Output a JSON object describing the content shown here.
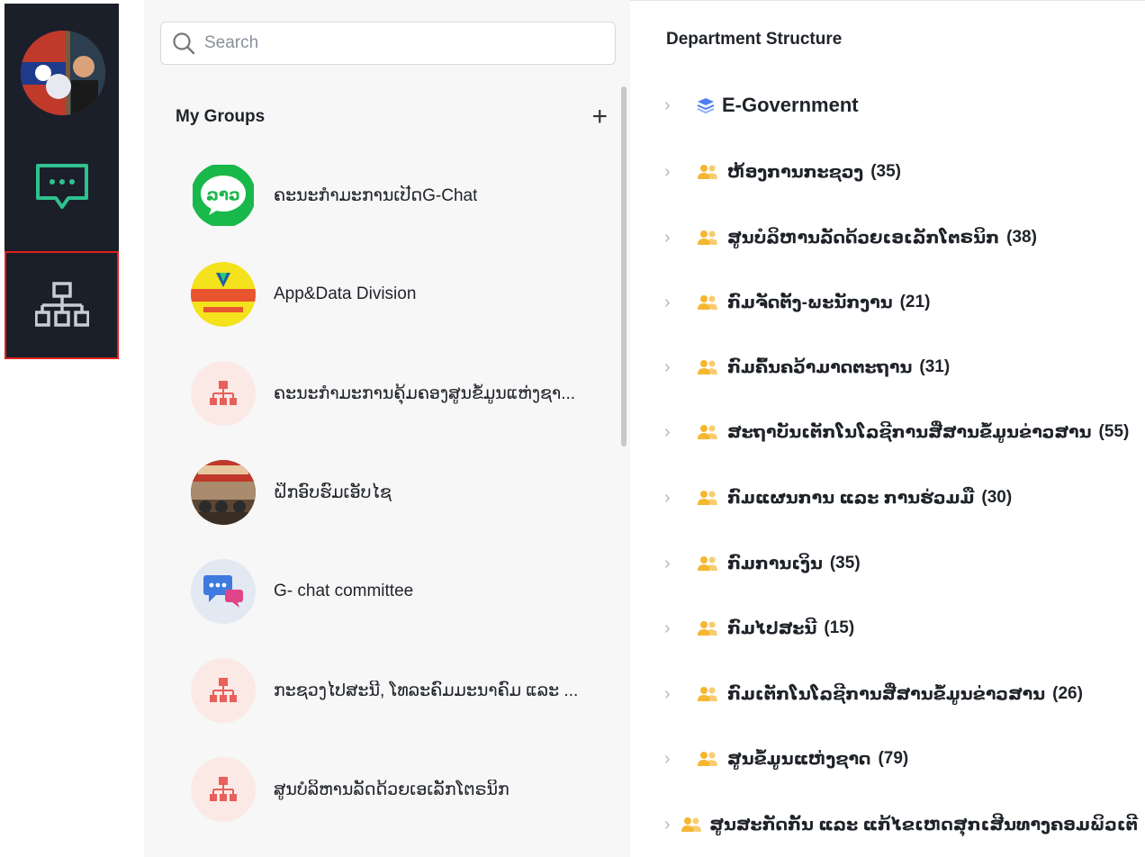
{
  "rail": {
    "items": [
      {
        "name": "chat",
        "icon": "chat-bubble-icon"
      },
      {
        "name": "organization",
        "icon": "org-chart-icon",
        "active": true
      }
    ],
    "colors": {
      "background": "#1b1f2a",
      "chat_icon": "#2ec28e",
      "active_border": "#e02020"
    }
  },
  "groups_panel": {
    "search": {
      "placeholder": "Search",
      "value": ""
    },
    "title": "My Groups",
    "add_label": "+",
    "items": [
      {
        "name": "ຄະນະກຳມະການເປີດG-Chat",
        "avatar": "lao-chat-logo"
      },
      {
        "name": "App&Data Division",
        "avatar": "application-data-logo"
      },
      {
        "name": "ຄະນະກຳມະການຄຸ້ມຄອງສູນຂໍ້ມູນແຫ່ງຊາ...",
        "avatar": "org-chart-icon"
      },
      {
        "name": "ຝຶກອົບຮົມເອັບໄຊ",
        "avatar": "photo"
      },
      {
        "name": "G- chat committee",
        "avatar": "chat-bubbles-icon"
      },
      {
        "name": "ກະຊວງໄປສະນີ, ໂທລະຄົມມະນາຄົມ ແລະ ...",
        "avatar": "org-chart-icon"
      },
      {
        "name": "ສູນບໍລິຫານລັດດ້ວຍເອເລັກໂຕຣນິກ",
        "avatar": "org-chart-icon"
      }
    ]
  },
  "department": {
    "title": "Department Structure",
    "root": {
      "label": "E-Government",
      "icon": "layers-icon"
    },
    "nodes": [
      {
        "label": "ຫ້ອງການກະຊວງ",
        "count": "(35)"
      },
      {
        "label": "ສູນບໍລິຫານລັດດ້ວຍເອເລັກໂຕຣນິກ",
        "count": "(38)"
      },
      {
        "label": "ກົມຈັດຕັ້ງ-ພະນັກງານ",
        "count": "(21)"
      },
      {
        "label": "ກົມຄົ້ນຄວ້າມາດຕະຖານ",
        "count": "(31)"
      },
      {
        "label": "ສະຖາບັນເຕັກໂນໂລຊີການສື່ສານຂໍ້ມູນຂ່າວສານ",
        "count": "(55)"
      },
      {
        "label": "ກົມແຜນການ ແລະ ການຮ່ວມມື",
        "count": "(30)"
      },
      {
        "label": "ກົມການເງິນ",
        "count": "(35)"
      },
      {
        "label": "ກົມໄປສະນີ",
        "count": "(15)"
      },
      {
        "label": "ກົມເຕັກໂນໂລຊີການສື່ສານຂໍ້ມູນຂ່າວສານ",
        "count": "(26)"
      },
      {
        "label": "ສູນຂໍ້ມູນແຫ່ງຊາດ",
        "count": "(79)"
      },
      {
        "label": "ສູນສະກັດກັ້ນ ແລະ ແກ້ໄຂເຫດສຸກເສີນທາງຄອມພິວເຕີ",
        "count": ""
      }
    ],
    "colors": {
      "group_icon": "#f5b731",
      "root_icon": "#4d7df0",
      "chevron": "#b5b8bd"
    }
  }
}
